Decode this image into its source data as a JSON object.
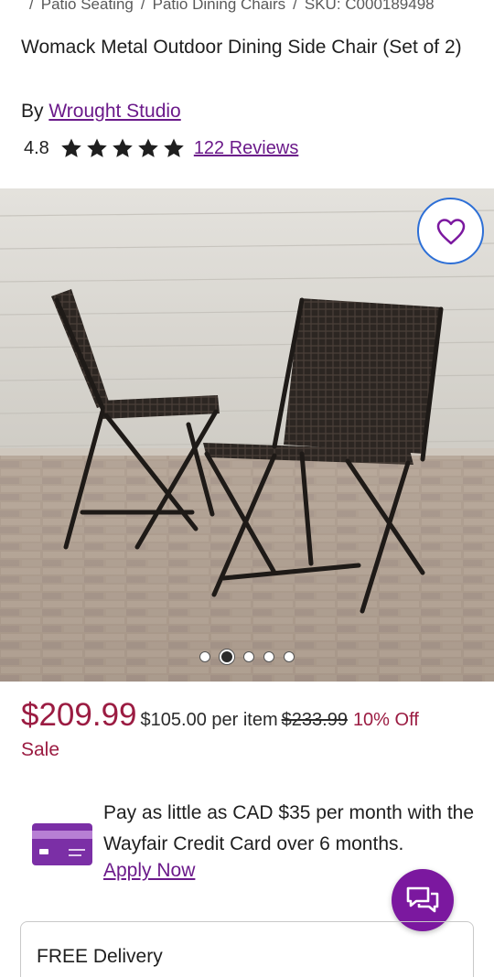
{
  "breadcrumb": {
    "items": [
      "Patio Seating",
      "Patio Dining Chairs"
    ],
    "sku": "SKU: C000189498"
  },
  "product": {
    "title": "Womack Metal Outdoor Dining Side Chair (Set of 2)",
    "by_prefix": "By",
    "brand": "Wrought Studio",
    "rating": "4.8",
    "stars": 5,
    "reviews_label": "122 Reviews"
  },
  "gallery": {
    "image_count": 5,
    "active_index": 1,
    "favorite_icon": "heart-icon"
  },
  "pricing": {
    "price": "$209.99",
    "per_item": "$105.00 per item",
    "was_price": "$233.99",
    "discount": "10% Off",
    "badge": "Sale"
  },
  "financing": {
    "text": "Pay as little as CAD $35 per month with the Wayfair Credit Card over 6 months.",
    "link": "Apply Now",
    "icon": "credit-card-icon"
  },
  "chat": {
    "icon": "chat-icon"
  },
  "delivery": {
    "label": "FREE Delivery"
  },
  "colors": {
    "brand_purple": "#7b189f",
    "sale_red": "#9b1c42",
    "link_purple": "#6b1a8a",
    "focus_blue": "#2d6fd6"
  }
}
